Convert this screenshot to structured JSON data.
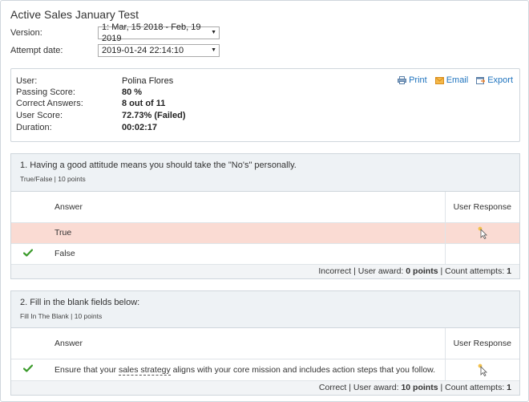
{
  "page": {
    "title": "Active Sales January Test"
  },
  "form": {
    "version_label": "Version:",
    "version_value": "1: Mar, 15 2018 - Feb, 19 2019",
    "attempt_label": "Attempt date:",
    "attempt_value": "2019-01-24 22:14:10"
  },
  "summary": {
    "rows": [
      {
        "label": "User:",
        "value": "Polina Flores"
      },
      {
        "label": "Passing Score:",
        "value": "80 %"
      },
      {
        "label": "Correct Answers:",
        "value": "8 out of 11"
      },
      {
        "label": "User Score:",
        "value": "72.73% (Failed)"
      },
      {
        "label": "Duration:",
        "value": "00:02:17"
      }
    ],
    "actions": {
      "print": "Print",
      "email": "Email",
      "export": "Export"
    }
  },
  "questions": [
    {
      "title": "1. Having a good attitude means you should take the \"No's\" personally.",
      "meta": "True/False | 10 points",
      "col_answer": "Answer",
      "col_response": "User Response",
      "answers": [
        {
          "text": "True",
          "correct": false,
          "selected": true
        },
        {
          "text": "False",
          "correct": true,
          "selected": false
        }
      ],
      "footer": {
        "status": "Incorrect",
        "award_label": "User award:",
        "award": "0 points",
        "attempts_label": "Count attempts:",
        "attempts": "1"
      }
    },
    {
      "title": "2. Fill in the blank fields below:",
      "meta": "Fill In The Blank | 10 points",
      "col_answer": "Answer",
      "col_response": "User Response",
      "answer": {
        "before": "Ensure that your ",
        "term": "sales strategy",
        "after": " aligns with your core mission and includes action steps that you follow."
      },
      "footer": {
        "status": "Correct",
        "award_label": "User award:",
        "award": "10 points",
        "attempts_label": "Count attempts:",
        "attempts": "1"
      }
    }
  ],
  "colors": {
    "link": "#1e73be",
    "check": "#3a9a2a",
    "wrong_row": "#fadbd3",
    "header_bg": "#eef2f5"
  },
  "icons": [
    "print-icon",
    "email-icon",
    "export-icon",
    "checkmark-icon",
    "cursor-icon",
    "chevron-down-icon"
  ]
}
